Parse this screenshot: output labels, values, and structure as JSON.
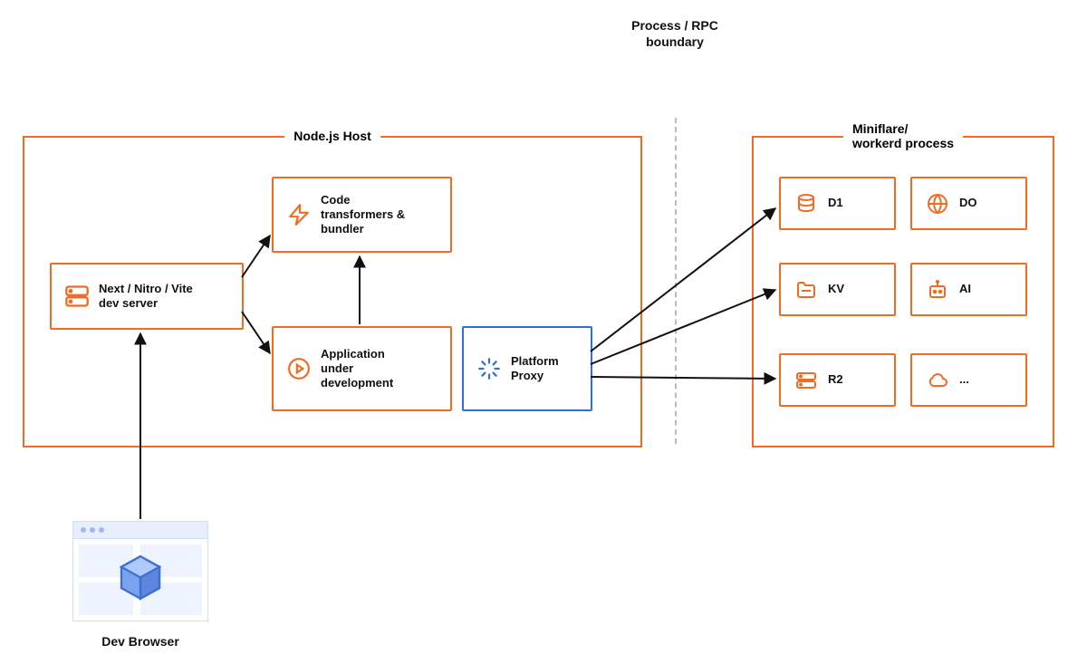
{
  "boundary_label": "Process / RPC\nboundary",
  "nodejs_host": {
    "title": "Node.js Host"
  },
  "miniflare": {
    "title": "Miniflare/\nworkerd process"
  },
  "dev_server": {
    "label": "Next / Nitro / Vite\ndev server"
  },
  "bundler": {
    "label": "Code\ntransformers &\nbundler"
  },
  "app": {
    "label": "Application\nunder\ndevelopment"
  },
  "proxy": {
    "label": "Platform\nProxy"
  },
  "services": {
    "d1": "D1",
    "do": "DO",
    "kv": "KV",
    "ai": "AI",
    "r2": "R2",
    "more": "..."
  },
  "dev_browser": {
    "label": "Dev Browser"
  }
}
